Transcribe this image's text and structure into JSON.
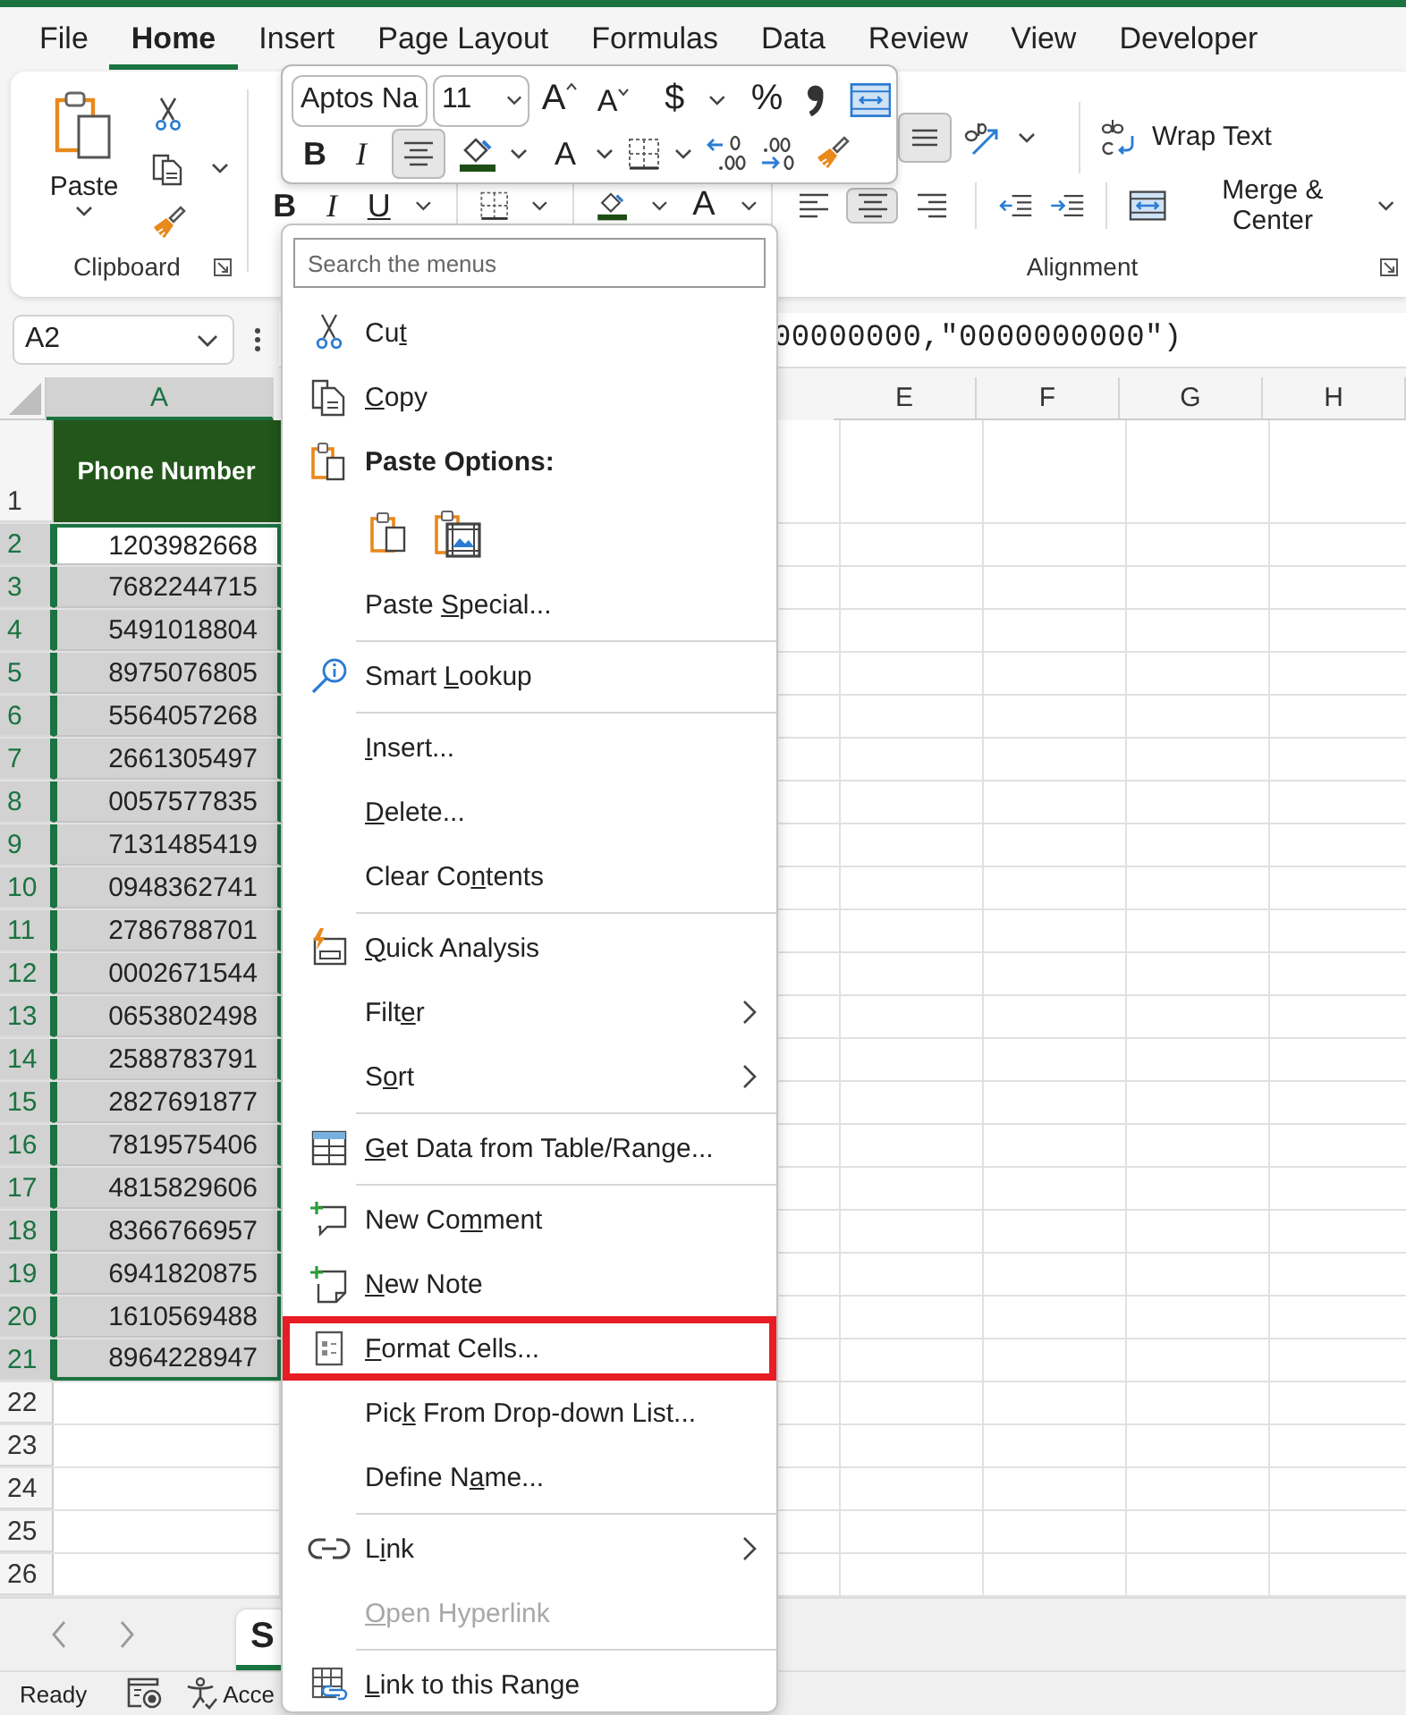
{
  "ribbon_tabs": [
    {
      "label": "File",
      "selected": false
    },
    {
      "label": "Home",
      "selected": true
    },
    {
      "label": "Insert",
      "selected": false
    },
    {
      "label": "Page Layout",
      "selected": false
    },
    {
      "label": "Formulas",
      "selected": false
    },
    {
      "label": "Data",
      "selected": false
    },
    {
      "label": "Review",
      "selected": false
    },
    {
      "label": "View",
      "selected": false
    },
    {
      "label": "Developer",
      "selected": false
    }
  ],
  "clipboard": {
    "paste": "Paste",
    "label": "Clipboard"
  },
  "font_group": {
    "bold": "B",
    "italic": "I",
    "underline": "U",
    "font_color": "A"
  },
  "alignment": {
    "label": "Alignment",
    "bottom_align_selected": true,
    "wrap_text": "Wrap Text",
    "merge": "Merge & Center",
    "horizontal": [
      {
        "kind": "left",
        "selected": false
      },
      {
        "kind": "center",
        "selected": true
      },
      {
        "kind": "right",
        "selected": false
      }
    ]
  },
  "mini_toolbar": {
    "font": "Aptos Na",
    "size": "11",
    "grow": "A",
    "shrink": "A",
    "currency": "$",
    "percent": "%",
    "bold": "B",
    "italic": "I",
    "center_selected": true,
    "font_color": "A"
  },
  "formula_bar": {
    "name_box": "A2",
    "formula": "00000000,\"0000000000\")"
  },
  "sheet": {
    "columns": [
      {
        "label": "A",
        "selected": true
      },
      {
        "label": "E",
        "selected": false
      },
      {
        "label": "F",
        "selected": false
      },
      {
        "label": "G",
        "selected": false
      },
      {
        "label": "H",
        "selected": false
      }
    ],
    "header_row": {
      "number": "1",
      "value": "Phone Number"
    },
    "rows": [
      {
        "number": "2",
        "value": "1203982668",
        "selected": true,
        "active": true
      },
      {
        "number": "3",
        "value": "7682244715",
        "selected": true,
        "active": false
      },
      {
        "number": "4",
        "value": "5491018804",
        "selected": true,
        "active": false
      },
      {
        "number": "5",
        "value": "8975076805",
        "selected": true,
        "active": false
      },
      {
        "number": "6",
        "value": "5564057268",
        "selected": true,
        "active": false
      },
      {
        "number": "7",
        "value": "2661305497",
        "selected": true,
        "active": false
      },
      {
        "number": "8",
        "value": "0057577835",
        "selected": true,
        "active": false
      },
      {
        "number": "9",
        "value": "7131485419",
        "selected": true,
        "active": false
      },
      {
        "number": "10",
        "value": "0948362741",
        "selected": true,
        "active": false
      },
      {
        "number": "11",
        "value": "2786788701",
        "selected": true,
        "active": false
      },
      {
        "number": "12",
        "value": "0002671544",
        "selected": true,
        "active": false
      },
      {
        "number": "13",
        "value": "0653802498",
        "selected": true,
        "active": false
      },
      {
        "number": "14",
        "value": "2588783791",
        "selected": true,
        "active": false
      },
      {
        "number": "15",
        "value": "2827691877",
        "selected": true,
        "active": false
      },
      {
        "number": "16",
        "value": "7819575406",
        "selected": true,
        "active": false
      },
      {
        "number": "17",
        "value": "4815829606",
        "selected": true,
        "active": false
      },
      {
        "number": "18",
        "value": "8366766957",
        "selected": true,
        "active": false
      },
      {
        "number": "19",
        "value": "6941820875",
        "selected": true,
        "active": false
      },
      {
        "number": "20",
        "value": "1610569488",
        "selected": true,
        "active": false
      },
      {
        "number": "21",
        "value": "8964228947",
        "selected": true,
        "active": false
      },
      {
        "number": "22",
        "selected": false
      },
      {
        "number": "23",
        "selected": false
      },
      {
        "number": "24",
        "selected": false
      },
      {
        "number": "25",
        "selected": false
      },
      {
        "number": "26",
        "selected": false
      }
    ]
  },
  "sheet_tabs": [
    {
      "label": "S",
      "selected": true
    }
  ],
  "status_bar": {
    "ready": "Ready",
    "accessibility": "Acce"
  },
  "context_menu": {
    "search_placeholder": "Search the menus",
    "items": [
      {
        "kind": "cut",
        "label": "Cut",
        "submenu": false,
        "disabled": false,
        "highlighted": false
      },
      {
        "kind": "copy",
        "label": "Copy",
        "submenu": false,
        "disabled": false,
        "highlighted": false
      },
      {
        "kind": "heading",
        "label": "Paste Options:"
      },
      {
        "kind": "paste_options"
      },
      {
        "kind": "plain",
        "label": "Paste Special...",
        "submenu": false,
        "disabled": false,
        "highlighted": false
      },
      {
        "kind": "separator"
      },
      {
        "kind": "lookup",
        "label": "Smart Lookup",
        "submenu": false,
        "disabled": false,
        "highlighted": false
      },
      {
        "kind": "separator"
      },
      {
        "kind": "plain",
        "label": "Insert...",
        "submenu": false,
        "disabled": false,
        "highlighted": false
      },
      {
        "kind": "plain",
        "label": "Delete...",
        "submenu": false,
        "disabled": false,
        "highlighted": false
      },
      {
        "kind": "plain",
        "label": "Clear Contents",
        "submenu": false,
        "disabled": false,
        "highlighted": false
      },
      {
        "kind": "separator"
      },
      {
        "kind": "quick",
        "label": "Quick Analysis",
        "submenu": false,
        "disabled": false,
        "highlighted": false
      },
      {
        "kind": "plain",
        "label": "Filter",
        "submenu": true,
        "disabled": false,
        "highlighted": false
      },
      {
        "kind": "plain",
        "label": "Sort",
        "submenu": true,
        "disabled": false,
        "highlighted": false
      },
      {
        "kind": "separator"
      },
      {
        "kind": "table",
        "label": "Get Data from Table/Range...",
        "submenu": false,
        "disabled": false,
        "highlighted": false
      },
      {
        "kind": "separator"
      },
      {
        "kind": "comment",
        "label": "New Comment",
        "submenu": false,
        "disabled": false,
        "highlighted": false
      },
      {
        "kind": "note",
        "label": "New Note",
        "submenu": false,
        "disabled": false,
        "highlighted": false
      },
      {
        "kind": "format",
        "label": "Format Cells...",
        "submenu": false,
        "disabled": false,
        "highlighted": true
      },
      {
        "kind": "plain",
        "label": "Pick From Drop-down List...",
        "submenu": false,
        "disabled": false,
        "highlighted": false
      },
      {
        "kind": "plain",
        "label": "Define Name...",
        "submenu": false,
        "disabled": false,
        "highlighted": false
      },
      {
        "kind": "separator"
      },
      {
        "kind": "link",
        "label": "Link",
        "submenu": true,
        "disabled": false,
        "highlighted": false
      },
      {
        "kind": "plain",
        "label": "Open Hyperlink",
        "submenu": false,
        "disabled": true,
        "highlighted": false
      },
      {
        "kind": "separator"
      },
      {
        "kind": "linkrange",
        "label": "Link to this Range",
        "submenu": false,
        "disabled": false,
        "highlighted": false
      }
    ]
  }
}
